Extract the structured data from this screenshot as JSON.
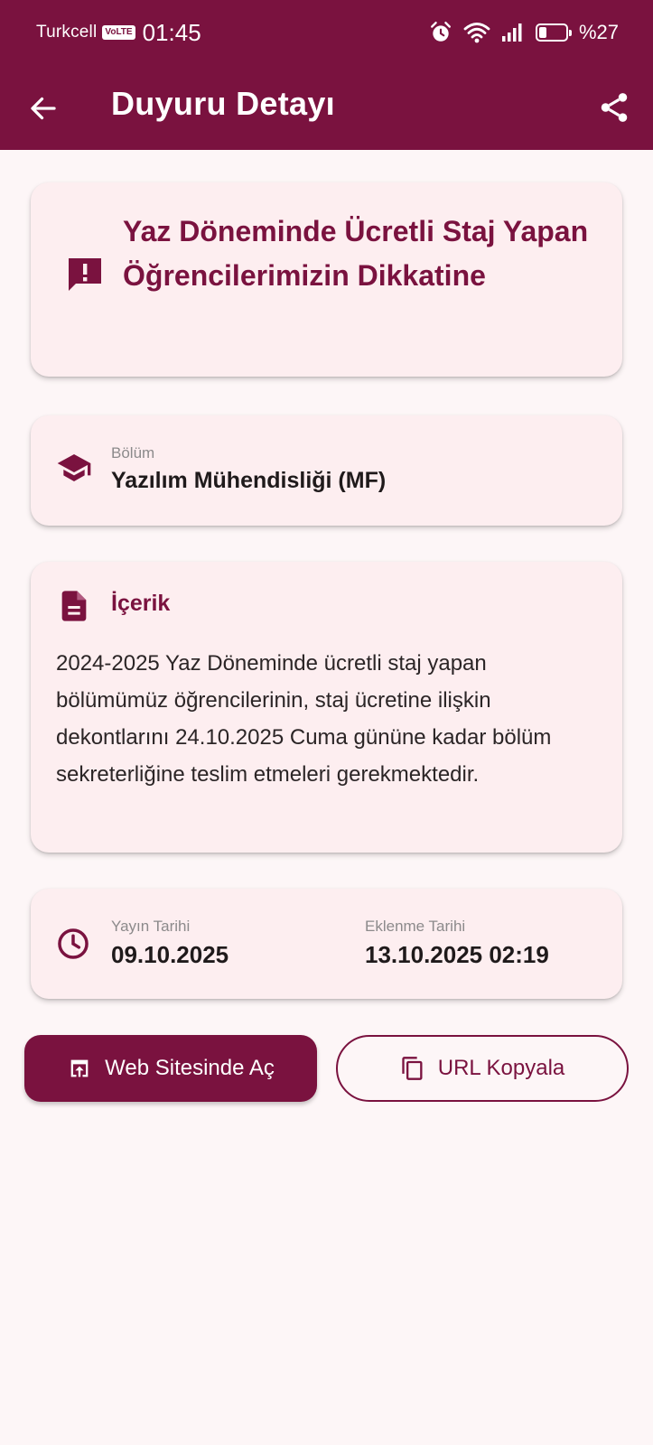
{
  "statusbar": {
    "carrier": "Turkcell",
    "volte": "VoLTE",
    "time": "01:45",
    "battery": "%27",
    "icons": [
      "alarm-icon",
      "wifi-icon",
      "signal-icon",
      "battery-icon"
    ]
  },
  "appbar": {
    "title": "Duyuru Detayı",
    "back_icon": "arrow-left-icon",
    "share_icon": "share-icon"
  },
  "announcement": {
    "title": "Yaz Döneminde Ücretli Staj Yapan Öğrencilerimizin Dikkatine",
    "icon": "announcement-icon"
  },
  "department": {
    "label": "Bölüm",
    "value": "Yazılım Mühendisliği (MF)",
    "icon": "graduation-cap-icon"
  },
  "content": {
    "heading": "İçerik",
    "body": "2024-2025 Yaz Döneminde ücretli staj yapan bölümümüz öğrencilerinin, staj ücretine ilişkin dekontlarını 24.10.2025 Cuma gününe kadar bölüm sekreterliğine teslim etmeleri gerekmektedir.",
    "icon": "document-icon"
  },
  "dates": {
    "published_label": "Yayın Tarihi",
    "published_value": "09.10.2025",
    "added_label": "Eklenme Tarihi",
    "added_value": "13.10.2025 02:19",
    "icon": "clock-icon"
  },
  "actions": {
    "open_web": "Web Sitesinde Aç",
    "copy_url": "URL Kopyala"
  },
  "colors": {
    "primary": "#7a123f",
    "card_bg": "#fdeef0",
    "page_bg": "#fdf6f7"
  }
}
